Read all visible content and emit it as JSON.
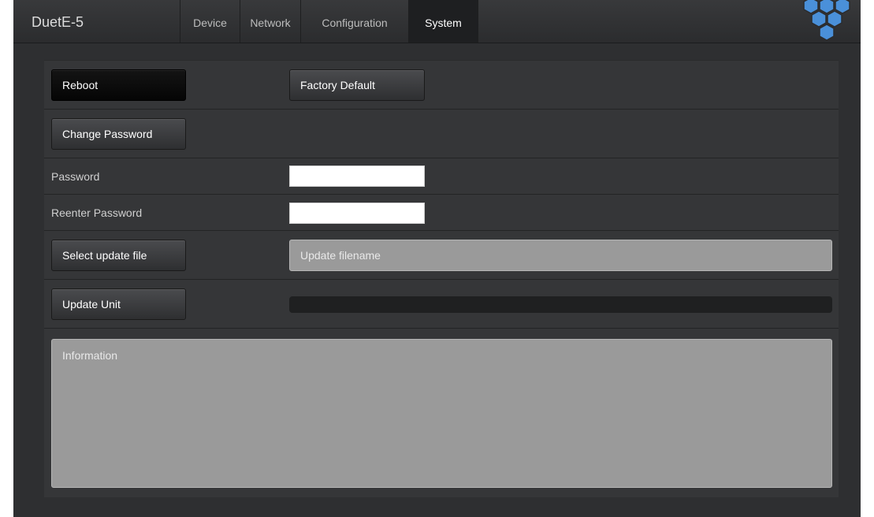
{
  "app": {
    "brand": "DuetE-5",
    "logo_icon": "hexagon-cluster-icon",
    "accent_color": "#3f87c9"
  },
  "nav": {
    "tabs": [
      {
        "label": "Device",
        "active": false
      },
      {
        "label": "Network",
        "active": false
      },
      {
        "label": "Configuration",
        "active": false
      },
      {
        "label": "System",
        "active": true
      }
    ]
  },
  "system": {
    "reboot_label": "Reboot",
    "factory_default_label": "Factory Default",
    "change_password_label": "Change Password",
    "password_label": "Password",
    "password_value": "",
    "reenter_password_label": "Reenter Password",
    "reenter_password_value": "",
    "select_update_file_label": "Select update file",
    "update_filename_placeholder": "Update filename",
    "update_unit_label": "Update Unit",
    "update_progress": 0,
    "information_placeholder": "Information"
  }
}
